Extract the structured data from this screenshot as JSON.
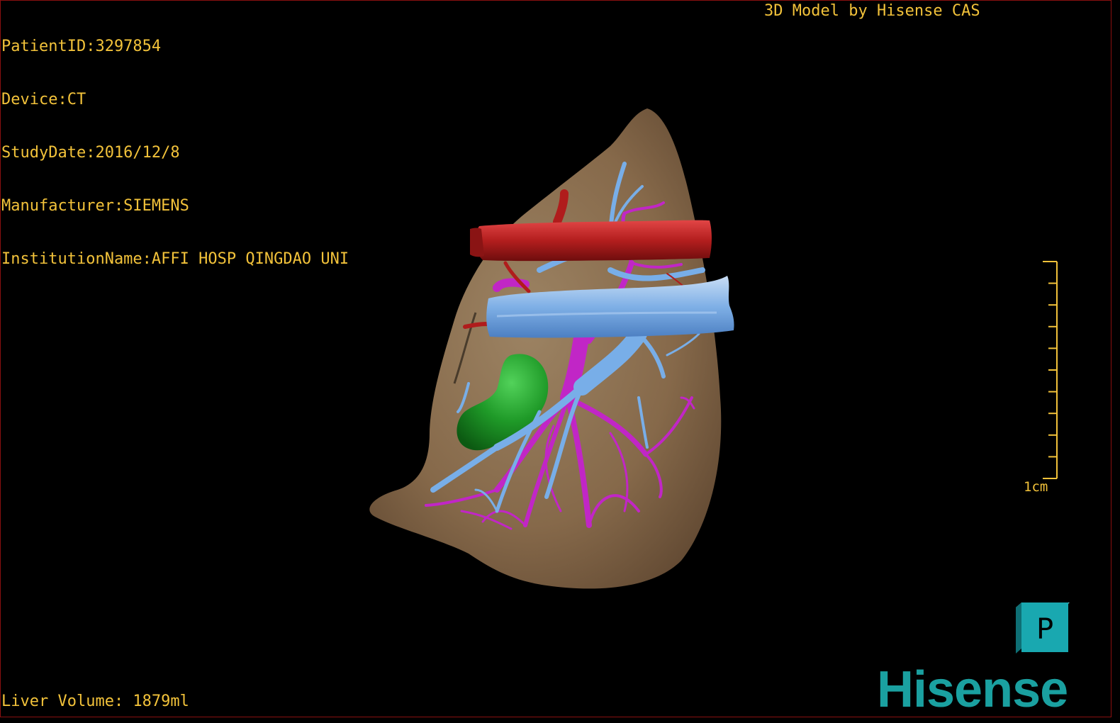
{
  "patient_info": {
    "patient_id": "PatientID:3297854",
    "device": "Device:CT",
    "study_date": "StudyDate:2016/12/8",
    "manufacturer": "Manufacturer:SIEMENS",
    "institution": "InstitutionName:AFFI HOSP QINGDAO UNI"
  },
  "header_brand": "3D Model by Hisense CAS",
  "liver_volume": "Liver Volume: 1879ml",
  "scale_bar": {
    "label": "1cm",
    "ticks": 10
  },
  "orientation_cube": {
    "face_label": "P"
  },
  "logo_text": "Hisense",
  "colors": {
    "overlay_text": "#f2c23a",
    "liver": "#8a7152",
    "artery": "#b01c1c",
    "portal_vein": "#c126c6",
    "hepatic_vein": "#78aee8",
    "gallbladder": "#1f9a28",
    "logo": "#1aa0a0",
    "cube": "#19a8b0"
  },
  "icons": [
    "orientation-cube-icon"
  ]
}
